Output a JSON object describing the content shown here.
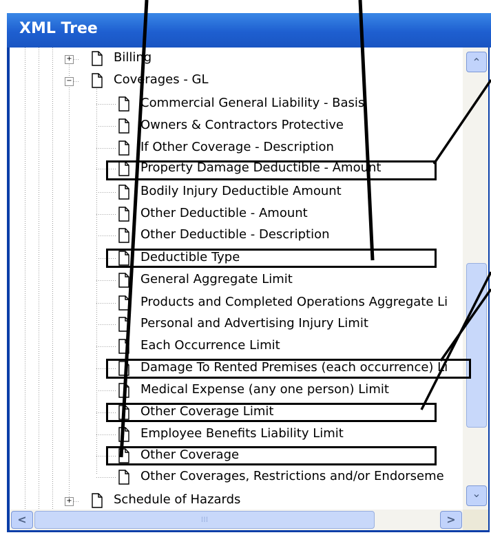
{
  "window": {
    "title": "XML Tree"
  },
  "tree": {
    "nodes": [
      {
        "label": "Billing",
        "expander": "+"
      },
      {
        "label": "Coverages - GL",
        "expander": "−"
      },
      {
        "label": "Commercial General Liability - Basis"
      },
      {
        "label": "Owners & Contractors Protective"
      },
      {
        "label": "If Other Coverage - Description"
      },
      {
        "label": "Property Damage Deductible - Amount"
      },
      {
        "label": "Bodily Injury Deductible Amount"
      },
      {
        "label": "Other Deductible - Amount"
      },
      {
        "label": "Other Deductible - Description"
      },
      {
        "label": "Deductible Type"
      },
      {
        "label": "General Aggregate Limit"
      },
      {
        "label": "Products and Completed Operations Aggregate Li"
      },
      {
        "label": "Personal and Advertising Injury Limit"
      },
      {
        "label": "Each Occurrence Limit"
      },
      {
        "label": "Damage To Rented Premises (each occurrence) Li"
      },
      {
        "label": "Medical Expense (any one person) Limit"
      },
      {
        "label": "Other Coverage Limit"
      },
      {
        "label": "Employee Benefits Liability Limit"
      },
      {
        "label": "Other Coverage"
      },
      {
        "label": "Other Coverages, Restrictions and/or Endorseme"
      },
      {
        "label": "Schedule of Hazards",
        "expander": "+"
      }
    ]
  },
  "scrollbar": {
    "up_glyph": "⌃",
    "down_glyph": "⌄",
    "left_glyph": "<",
    "right_glyph": ">",
    "grip_glyph": "⁞⁞⁞"
  }
}
